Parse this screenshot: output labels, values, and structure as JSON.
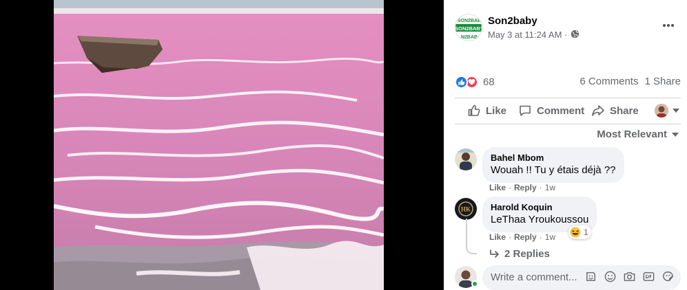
{
  "post": {
    "page_name": "Son2baby",
    "timestamp": "May 3 at 11:24 AM · ",
    "logo_text_top": "SON2BAB",
    "logo_text_mid": "SON2BABY",
    "logo_text_bottom": "N2BAB"
  },
  "reactions": {
    "count": "68",
    "comments": "6 Comments",
    "shares": "1 Share"
  },
  "actions": {
    "like": "Like",
    "comment": "Comment",
    "share": "Share"
  },
  "sort": {
    "label": "Most Relevant"
  },
  "comments": [
    {
      "author": "Bahel Mbom",
      "text": "Wouah !! Tu y étais déjà ??",
      "like": "Like",
      "reply": "Reply",
      "age": "1w"
    },
    {
      "author": "Harold Koquin",
      "text": "LeThaa Yroukoussou",
      "like": "Like",
      "reply": "Reply",
      "age": "1w",
      "reaction_count": "1",
      "avatar_initials": "HK"
    }
  ],
  "replies_link": "2 Replies",
  "composer": {
    "placeholder": "Write a comment..."
  },
  "icons": [
    "globe-icon",
    "more-icon",
    "like-reaction-icon",
    "love-reaction-icon",
    "thumbs-up-icon",
    "comment-icon",
    "share-icon",
    "caret-down-icon",
    "reply-arrow-icon",
    "haha-reaction-icon",
    "sticker-icon",
    "emoji-icon",
    "camera-icon",
    "gif-icon",
    "sticker-alt-icon"
  ],
  "colors": {
    "facebook_blue": "#1877f2",
    "love_red": "#f33e58",
    "secondary_text": "#65676b",
    "bubble_bg": "#f0f2f5",
    "online_green": "#31a24c",
    "lake_pink": "#d987b8"
  }
}
